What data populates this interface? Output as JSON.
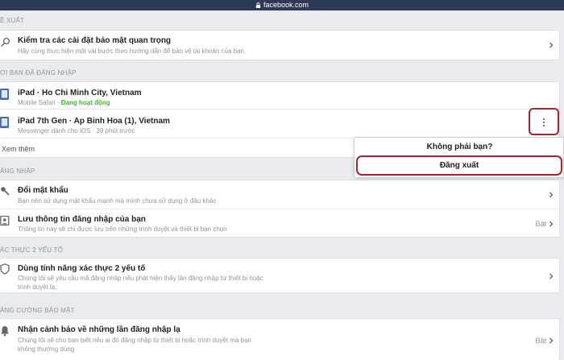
{
  "browser": {
    "url": "facebook.com"
  },
  "sections": {
    "recommended": {
      "label": "Ề XUẤT"
    },
    "logged_in": {
      "label": "ƠI BẠN ĐÃ ĐĂNG NHẬP"
    },
    "login": {
      "label": "ĂNG NHẬP"
    },
    "two_factor": {
      "label": "ÁC THỰC 2 YẾU TỐ"
    },
    "extra": {
      "label": "ĂNG CƯỜNG BẢO MẬT"
    }
  },
  "check": {
    "title": "Kiểm tra các cài đặt bảo mật quan trọng",
    "subtitle": "Hãy cùng thực hiện một vài bước theo hướng dẫn để bảo vệ tài khoản của bạn."
  },
  "sessions": [
    {
      "device": "iPad · Ho Chi Minh City, Vietnam",
      "client": "Mobile Safari · ",
      "status": "Đang hoạt động"
    },
    {
      "device": "iPad 7th Gen · Ap Binh Hoa (1), Vietnam",
      "client": "Messenger dành cho iOS · 39 phút trước",
      "status": ""
    }
  ],
  "see_more": "Xem thêm",
  "menu": {
    "not_you": "Không phải bạn?",
    "logout": "Đăng xuất"
  },
  "login_rows": [
    {
      "title": "Đổi mật khẩu",
      "subtitle": "Bạn nên sử dụng mật khẩu mạnh mà mình chưa sử dụng ở đâu khác",
      "value": ""
    },
    {
      "title": "Lưu thông tin đăng nhập của bạn",
      "subtitle": "Thông tin này sẽ chỉ được lưu trên những trình duyệt và thiết bị bạn chọn",
      "value": "Bật"
    }
  ],
  "two_factor_row": {
    "title": "Dùng tính năng xác thực 2 yếu tố",
    "subtitle": "Chúng tôi sẽ yêu cầu mã đăng nhập nếu phát hiện thấy lần đăng nhập từ thiết bị hoặc trình duyệt lạ."
  },
  "alert_row": {
    "title": "Nhận cảnh báo về những lần đăng nhập lạ",
    "subtitle": "Chúng tôi sẽ cho bạn biết nếu ai đó đăng nhập từ thiết bị hoặc trình duyệt mà bạn không thường dùng",
    "value": "Bật"
  },
  "colors": {
    "accent_blue": "#4267b2",
    "highlight_red": "#a5252d",
    "active_green": "#42b72a"
  }
}
